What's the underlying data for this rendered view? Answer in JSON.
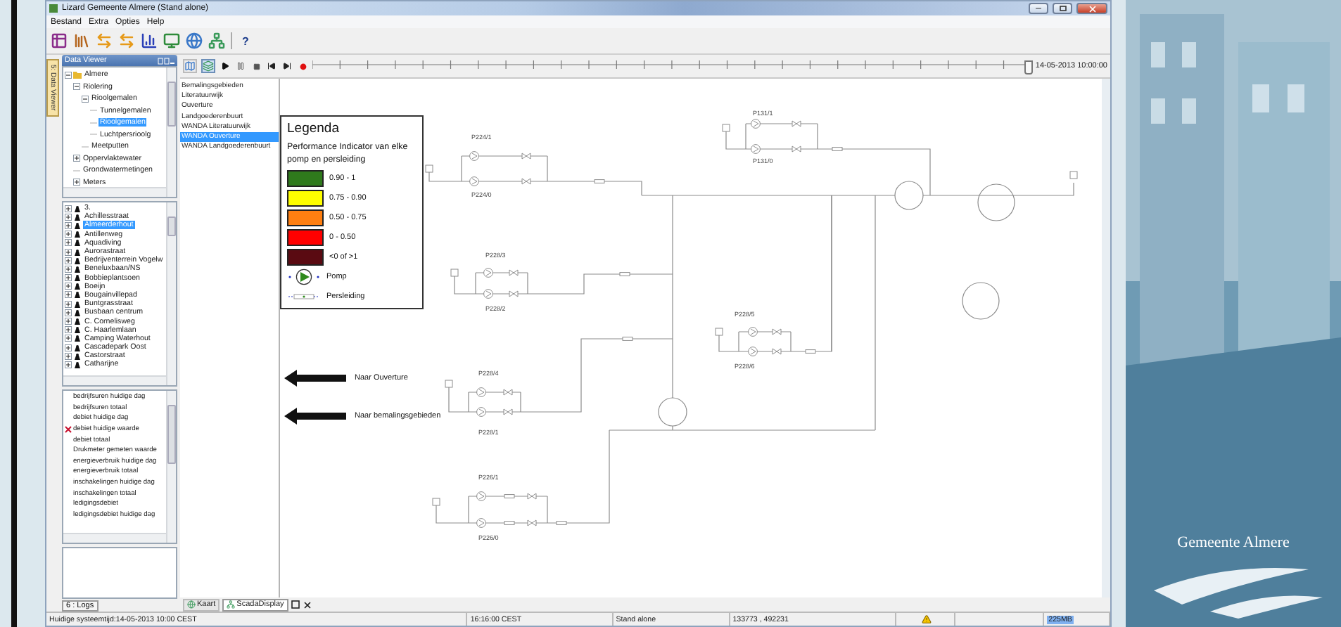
{
  "window": {
    "title": "Lizard Gemeente Almere (Stand alone)"
  },
  "menu": [
    "Bestand",
    "Extra",
    "Opties",
    "Help"
  ],
  "toolbar": {
    "help": "?"
  },
  "side_tab": "5: Data Viewer",
  "data_viewer": {
    "title": "Data Viewer",
    "tree": [
      {
        "label": "Almere",
        "expanded": true,
        "selected": false,
        "children": [
          {
            "label": "Riolering",
            "expanded": true,
            "selected": false,
            "children": [
              {
                "label": "Rioolgemalen",
                "expanded": true,
                "selected": false,
                "children": [
                  {
                    "label": "Tunnelgemalen",
                    "selected": false
                  },
                  {
                    "label": "Rioolgemalen",
                    "selected": true
                  },
                  {
                    "label": "Luchtpersrioolg",
                    "selected": false
                  }
                ]
              },
              {
                "label": "Meetputten",
                "selected": false
              }
            ]
          },
          {
            "label": "Oppervlaktewater",
            "expanded": false,
            "selected": false
          },
          {
            "label": "Grondwatermetingen",
            "selected": false
          },
          {
            "label": "Meters",
            "expanded": false,
            "selected": false
          }
        ]
      }
    ],
    "locations": [
      {
        "label": "3.",
        "selected": false
      },
      {
        "label": "Achillesstraat",
        "selected": false
      },
      {
        "label": "Almeerderhout",
        "selected": true
      },
      {
        "label": "Antillenweg",
        "selected": false
      },
      {
        "label": "Aquadiving",
        "selected": false
      },
      {
        "label": "Aurorastraat",
        "selected": false
      },
      {
        "label": "Bedrijventerrein Vogelw",
        "selected": false
      },
      {
        "label": "Beneluxbaan/NS",
        "selected": false
      },
      {
        "label": "Bobbieplantsoen",
        "selected": false
      },
      {
        "label": "Boeijn",
        "selected": false
      },
      {
        "label": "Bougainvillepad",
        "selected": false
      },
      {
        "label": "Buntgrasstraat",
        "selected": false
      },
      {
        "label": "Busbaan centrum",
        "selected": false
      },
      {
        "label": "C. Cornelisweg",
        "selected": false
      },
      {
        "label": "C. Haarlemlaan",
        "selected": false
      },
      {
        "label": "Camping Waterhout",
        "selected": false
      },
      {
        "label": "Cascadepark Oost",
        "selected": false
      },
      {
        "label": "Castorstraat",
        "selected": false
      },
      {
        "label": "Catharijne",
        "selected": false
      }
    ],
    "measurements": [
      {
        "label": "bedrijfsuren huidige dag",
        "flagged": false
      },
      {
        "label": "bedrijfsuren totaal",
        "flagged": false
      },
      {
        "label": "debiet huidige dag",
        "flagged": false
      },
      {
        "label": "debiet huidige waarde",
        "flagged": true
      },
      {
        "label": "debiet totaal",
        "flagged": false
      },
      {
        "label": "Drukmeter gemeten waarde",
        "flagged": false
      },
      {
        "label": "energieverbruik huidige dag",
        "flagged": false
      },
      {
        "label": "energieverbruik totaal",
        "flagged": false
      },
      {
        "label": "inschakelingen huidige dag",
        "flagged": false
      },
      {
        "label": "inschakelingen totaal",
        "flagged": false
      },
      {
        "label": "ledigingsdebiet",
        "flagged": false
      },
      {
        "label": "ledigingsdebiet huidige dag",
        "flagged": false
      }
    ]
  },
  "logs_tab": "6 : Logs",
  "timeline": {
    "label": "14-05-2013 10:00:00",
    "level": 1
  },
  "layers": [
    {
      "label": "Bemalingsgebieden",
      "selected": false
    },
    {
      "label": "Literatuurwijk",
      "selected": false
    },
    {
      "label": "Ouverture",
      "selected": false
    },
    {
      "label": "Landgoederenbuurt",
      "selected": false
    },
    {
      "label": "WANDA Literatuurwijk",
      "selected": false
    },
    {
      "label": "WANDA Ouverture",
      "selected": true
    },
    {
      "label": "WANDA Landgoederenbuurt",
      "selected": false
    }
  ],
  "legend": {
    "title": "Legenda",
    "subtitle": "Performance Indicator van elke pomp en persleiding",
    "entries": [
      {
        "kind": "swatch",
        "color": "#2f7a1c",
        "label": "0.90 - 1"
      },
      {
        "kind": "swatch",
        "color": "#ffff00",
        "label": "0.75 - 0.90"
      },
      {
        "kind": "swatch",
        "color": "#ff7f11",
        "label": "0.50 - 0.75"
      },
      {
        "kind": "swatch",
        "color": "#ff0000",
        "label": "0 - 0.50"
      },
      {
        "kind": "swatch",
        "color": "#5a0a12",
        "label": "<0 of >1"
      },
      {
        "kind": "pump",
        "label": "Pomp"
      },
      {
        "kind": "pipe",
        "label": "Persleiding"
      }
    ]
  },
  "nav_arrows": [
    {
      "label": "Naar Ouverture"
    },
    {
      "label": "Naar bemalingsgebieden"
    }
  ],
  "stations": [
    {
      "top": "P224/1",
      "bottom": "P224/0"
    },
    {
      "top": "P131/1",
      "bottom": "P131/0"
    },
    {
      "top": "P228/3",
      "bottom": "P228/2"
    },
    {
      "top": "P228/4",
      "bottom": "P228/1"
    },
    {
      "top": "P226/1",
      "bottom": "P226/0"
    },
    {
      "top": "P228/5",
      "bottom": "P228/6"
    }
  ],
  "bottom_tabs": [
    {
      "label": "Kaart",
      "selected": false
    },
    {
      "label": "ScadaDisplay",
      "selected": true
    }
  ],
  "status_bar": {
    "system_time": "Huidige systeemtijd:14-05-2013 10:00 CEST",
    "clock": "16:16:00 CEST",
    "mode": "Stand alone",
    "coordinates": "133773 , 492231",
    "warning": true,
    "memory": "225MB"
  },
  "wallpaper": {
    "caption": "Gemeente Almere"
  }
}
